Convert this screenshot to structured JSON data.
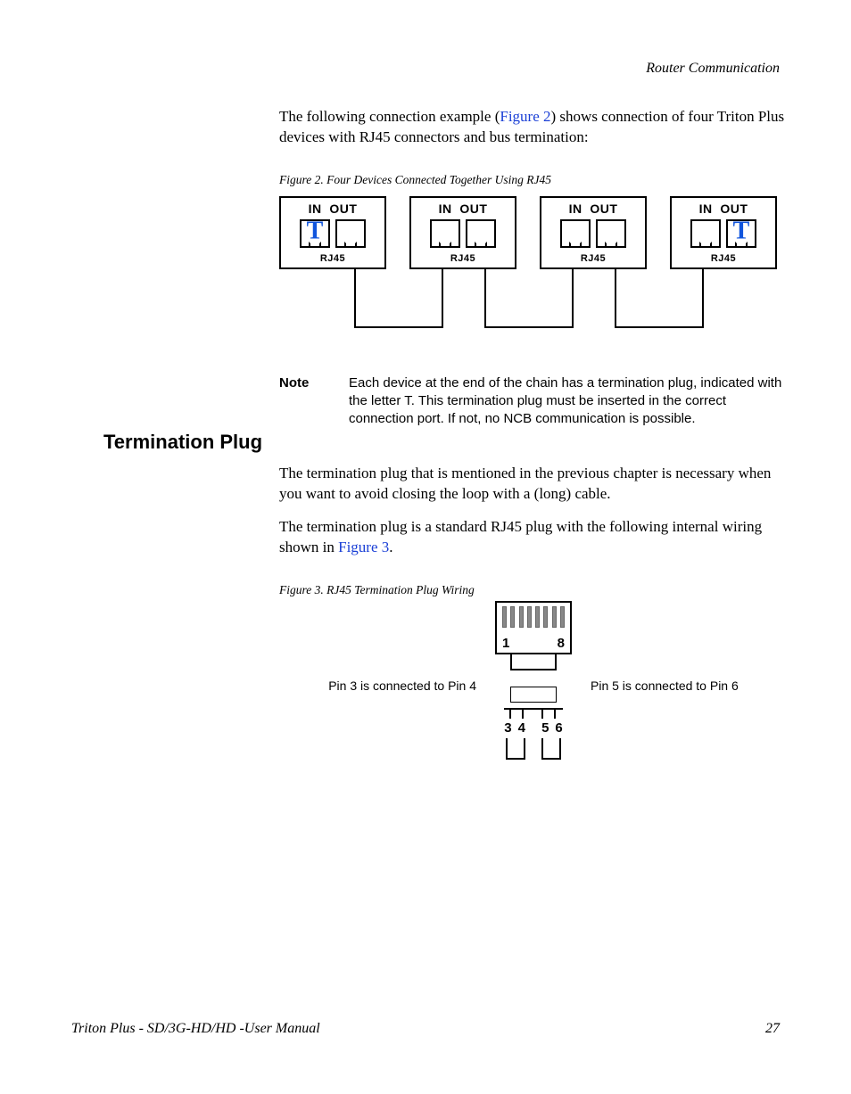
{
  "header": {
    "section": "Router Communication"
  },
  "intro": {
    "p1a": "The following connection example (",
    "p1link": "Figure 2",
    "p1b": ") shows connection of four Triton Plus devices with RJ45 connectors and bus termination:"
  },
  "fig2": {
    "caption": "Figure 2.  Four Devices Connected Together Using RJ45",
    "in": "IN",
    "out": "OUT",
    "rj": "RJ45",
    "t": "T"
  },
  "note": {
    "label": "Note",
    "text": "Each device at the end of the chain has a termination plug, indicated with the letter T. This termination plug must be inserted in the correct connection port. If not, no NCB communication is possible."
  },
  "section": {
    "title": "Termination Plug"
  },
  "term": {
    "p1": "The termination plug that is mentioned in the previous chapter is necessary when you want to avoid closing the loop with a (long) cable.",
    "p2a": "The termination plug is a standard RJ45 plug with the following internal wiring shown in ",
    "p2link": "Figure 3",
    "p2b": "."
  },
  "fig3": {
    "caption": "Figure 3.  RJ45 Termination Plug Wiring",
    "left": "Pin 3 is connected to Pin 4",
    "right": "Pin 5 is connected to Pin 6",
    "pin1": "1",
    "pin8": "8",
    "n3": "3",
    "n4": "4",
    "n5": "5",
    "n6": "6"
  },
  "footer": {
    "left": "Triton Plus - SD/3G-HD/HD -User Manual",
    "page": "27"
  }
}
